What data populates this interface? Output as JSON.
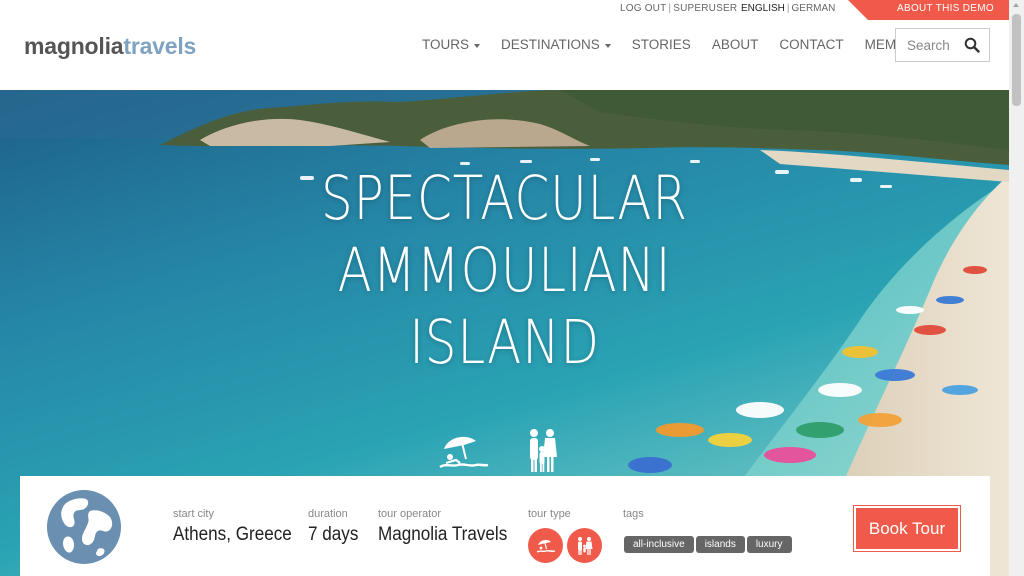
{
  "meta": {
    "logout": "LOG OUT",
    "user": "SUPERUSER",
    "sep": "|",
    "lang_active": "ENGLISH",
    "lang_other": "GERMAN",
    "demo_label": "ABOUT THIS DEMO"
  },
  "header": {
    "logo_part1": "magnolia",
    "logo_part2": "travels",
    "nav": {
      "tours": "TOURS",
      "destinations": "DESTINATIONS",
      "stories": "STORIES",
      "about": "ABOUT",
      "contact": "CONTACT",
      "members": "MEMBERS"
    },
    "search_placeholder": "Search"
  },
  "hero": {
    "title_line1": "SPECTACULAR",
    "title_line2": "AMMOULIANI",
    "title_line3": "ISLAND",
    "icons": [
      "beach-icon",
      "family-icon"
    ]
  },
  "tour": {
    "start_city_label": "start city",
    "start_city": "Athens, Greece",
    "duration_label": "duration",
    "duration": "7 days",
    "operator_label": "tour operator",
    "operator": "Magnolia Travels",
    "tour_type_label": "tour type",
    "tour_type_icons": [
      "beach-icon",
      "family-icon"
    ],
    "tags_label": "tags",
    "tags": [
      "all-inclusive",
      "islands",
      "luxury"
    ],
    "book_label": "Book Tour"
  },
  "colors": {
    "accent": "#f05a4a",
    "logo_blue": "#7ea2c0",
    "text_gray": "#666666",
    "tag_gray": "#666666"
  }
}
